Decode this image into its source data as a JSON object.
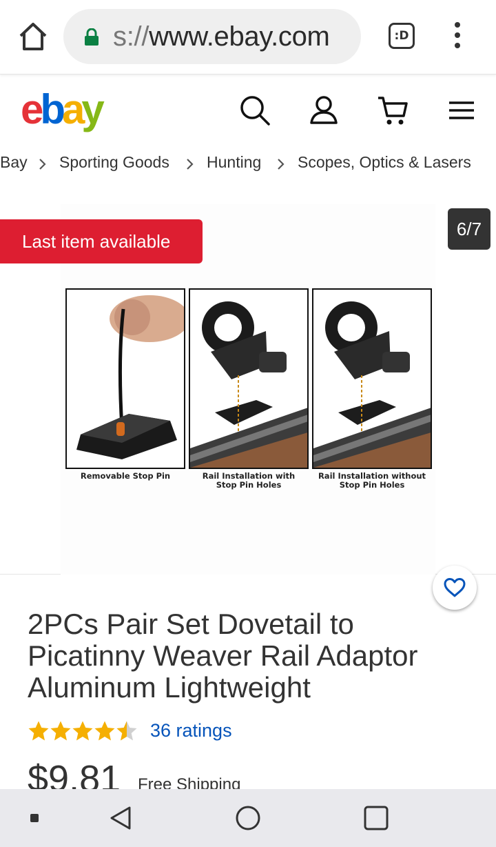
{
  "browser": {
    "url_prefix": "s://",
    "url_domain": "www.ebay.com",
    "tabs_label": ":D"
  },
  "header": {
    "logo": {
      "e": "e",
      "b": "b",
      "a": "a",
      "y": "y"
    }
  },
  "breadcrumb": [
    "Bay",
    "Sporting Goods",
    "Hunting",
    "Scopes, Optics & Lasers"
  ],
  "gallery": {
    "badge": "Last item available",
    "counter": "6/7",
    "captions": {
      "one": "Removable Stop Pin",
      "two_line1": "Rail Installation with",
      "two_line2": "Stop Pin Holes",
      "three_line1": "Rail Installation without",
      "three_line2": "Stop Pin Holes"
    }
  },
  "product": {
    "title": "2PCs Pair Set Dovetail to Picatinny Weaver Rail Adaptor Aluminum Lightweight",
    "rating_value": 4.5,
    "ratings_text": "36 ratings",
    "price": "$9.81",
    "shipping": "Free Shipping"
  },
  "colors": {
    "badge": "#dd1e31",
    "link": "#0654ba",
    "star": "#f5af02"
  },
  "icons": [
    "home-icon",
    "lock-icon",
    "tabs-icon",
    "more-vert-icon",
    "search-icon",
    "account-icon",
    "cart-icon",
    "hamburger-icon",
    "heart-icon",
    "back-icon",
    "home-circle-icon",
    "recents-icon"
  ]
}
